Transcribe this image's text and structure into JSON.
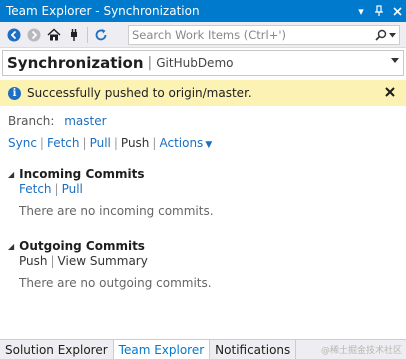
{
  "window": {
    "title": "Team Explorer - Synchronization",
    "buttons": {
      "dropdown": "▾",
      "pin": "⊥",
      "close": "×"
    }
  },
  "toolbar": {
    "icons": [
      "back-icon",
      "forward-icon",
      "home-icon",
      "connect-icon",
      "refresh-icon"
    ],
    "search_placeholder": "Search Work Items (Ctrl+')"
  },
  "page_header": {
    "title": "Synchronization",
    "separator": "|",
    "subtitle": "GitHubDemo"
  },
  "notification": {
    "message": "Successfully pushed to origin/master.",
    "color": "#fcf2b3"
  },
  "branch": {
    "label": "Branch:",
    "value": "master"
  },
  "actions": {
    "sync": "Sync",
    "fetch": "Fetch",
    "pull": "Pull",
    "push": "Push",
    "actions": "Actions",
    "separator": "|"
  },
  "incoming": {
    "title": "Incoming Commits",
    "fetch": "Fetch",
    "pull": "Pull",
    "separator": "|",
    "empty": "There are no incoming commits."
  },
  "outgoing": {
    "title": "Outgoing Commits",
    "push": "Push",
    "view_summary": "View Summary",
    "separator": "|",
    "empty": "There are no outgoing commits."
  },
  "tabs": [
    {
      "label": "Solution Explorer"
    },
    {
      "label": "Team Explorer"
    },
    {
      "label": "Notifications"
    }
  ],
  "watermark": "@稀土掘金技术社区",
  "colors": {
    "accent": "#007acc",
    "link": "#1c6fc1"
  }
}
